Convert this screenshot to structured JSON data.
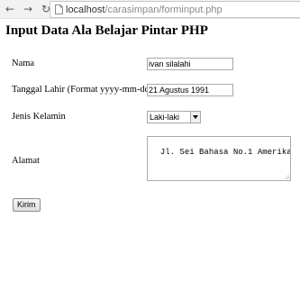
{
  "browser": {
    "back_icon": "←",
    "forward_icon": "→",
    "reload_icon": "↻",
    "url_host": "localhost",
    "url_path": "/carasimpan/forminput.php"
  },
  "page": {
    "title": "Input Data Ala Belajar Pintar PHP"
  },
  "form": {
    "nama_label": "Nama",
    "nama_value": "ivan silalahi",
    "tanggal_label": "Tanggal Lahir (Format yyyy-mm-dd)",
    "tanggal_value": "21 Agustus 1991",
    "jenis_label": "Jenis Kelamin",
    "jenis_value": "Laki-laki",
    "alamat_label": "Alamat",
    "alamat_value": "Jl. Sei Bahasa No.1 Amerika",
    "submit_label": "Kirim"
  }
}
